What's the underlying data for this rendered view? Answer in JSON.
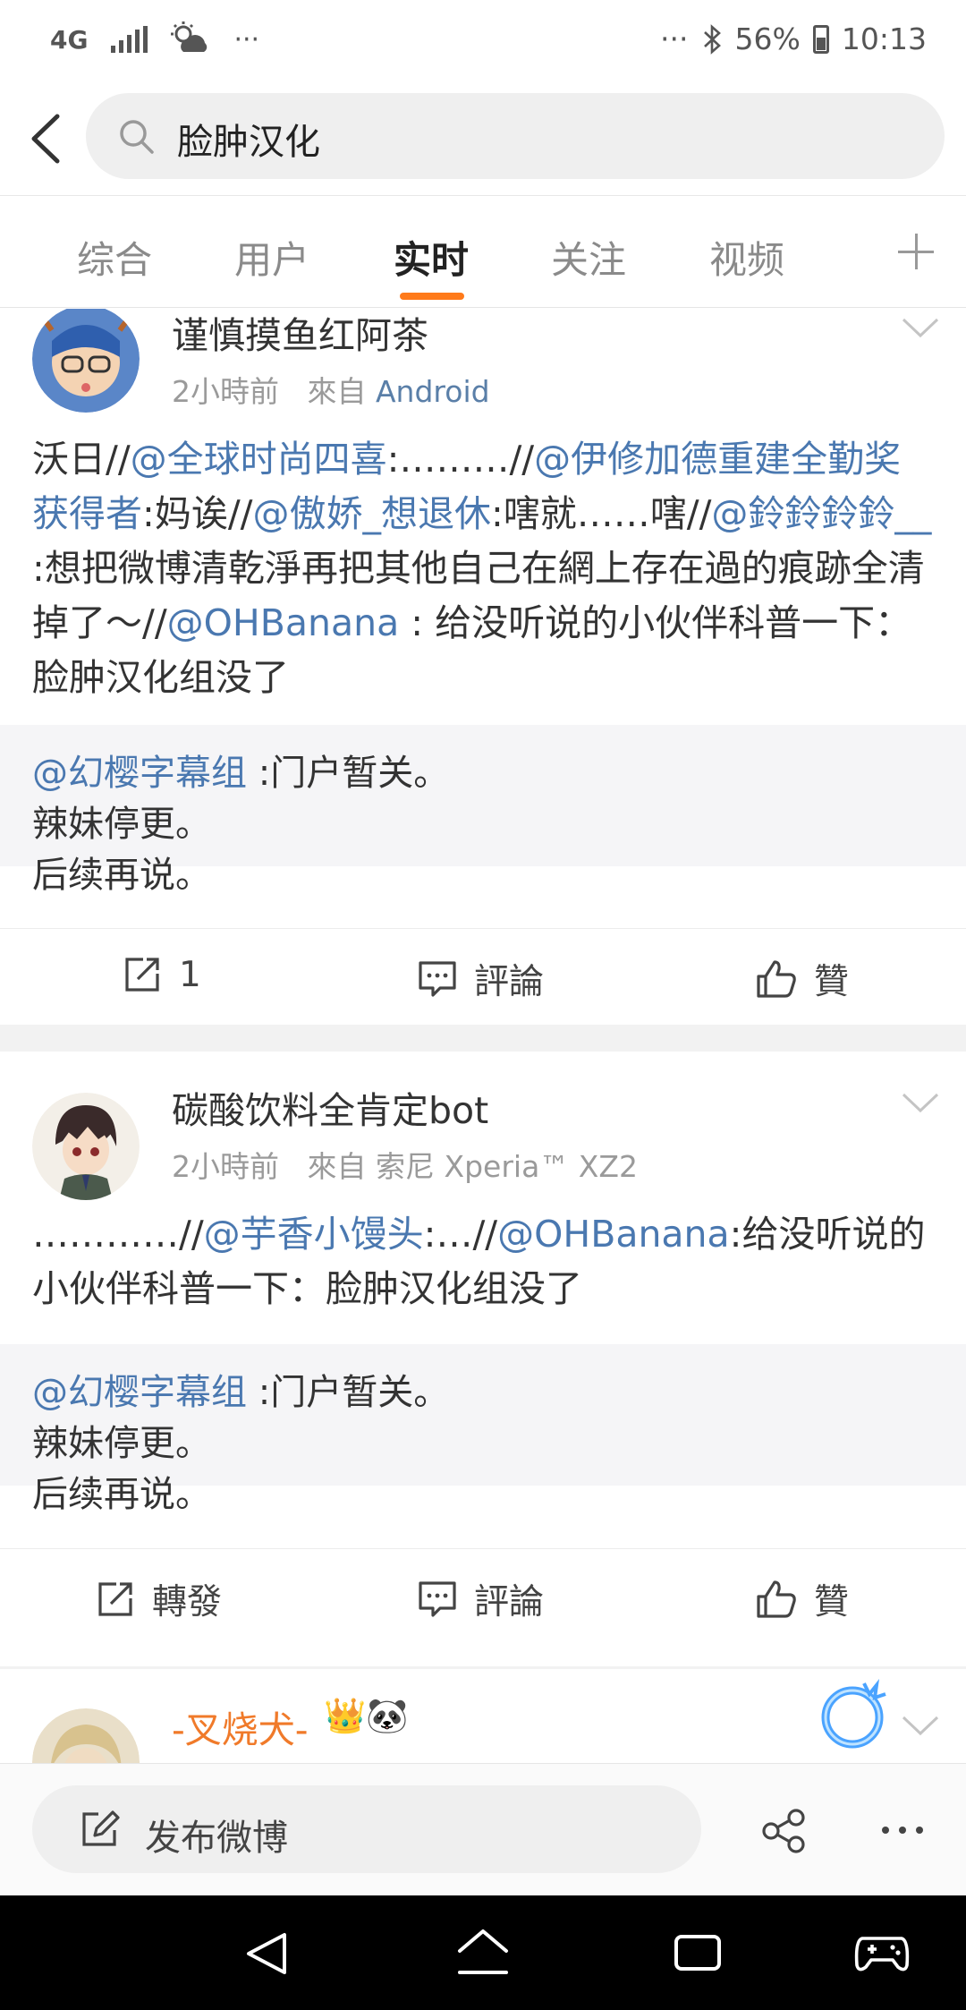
{
  "status_bar": {
    "network": "4G",
    "dots": "···",
    "right_dots": "···",
    "battery": "56%",
    "time": "10:13"
  },
  "search": {
    "query": "脸肿汉化"
  },
  "tabs": [
    {
      "label": "综合"
    },
    {
      "label": "用户"
    },
    {
      "label": "实时"
    },
    {
      "label": "关注"
    },
    {
      "label": "视频"
    }
  ],
  "active_tab": "实时",
  "posts": [
    {
      "author": "谨慎摸鱼红阿茶",
      "time": "2小時前",
      "from_label": "來自",
      "source": "Android",
      "text_parts": [
        {
          "t": "沃日//",
          "m": false
        },
        {
          "t": "@全球时尚四喜",
          "m": true
        },
        {
          "t": ":………//",
          "m": false
        },
        {
          "t": "@伊修加德重建全勤奖获得者",
          "m": true
        },
        {
          "t": ":妈诶//",
          "m": false
        },
        {
          "t": "@傲娇_想退休",
          "m": true
        },
        {
          "t": ":嗐就……嗐//",
          "m": false
        },
        {
          "t": "@鈴鈴鈴鈴__",
          "m": true
        },
        {
          "t": " :想把微博清乾淨再把其他自己在網上存在過的痕跡全清掉了～//",
          "m": false
        },
        {
          "t": "@OHBanana",
          "m": true
        },
        {
          "t": " : 给没听说的小伙伴科普一下：脸肿汉化组没了",
          "m": false
        }
      ],
      "quote_author": "@幻樱字幕组",
      "quote_lines": [
        ":门户暂关。",
        "辣妹停更。",
        "后续再说。"
      ],
      "repost_label": "1",
      "comment_label": "評論",
      "like_label": "贊"
    },
    {
      "author": "碳酸饮料全肯定bot",
      "time": "2小時前",
      "from_label": "來自",
      "source": "索尼 Xperia™ XZ2",
      "text_parts": [
        {
          "t": "…………//",
          "m": false
        },
        {
          "t": "@芋香小馒头",
          "m": true
        },
        {
          "t": ":…//",
          "m": false
        },
        {
          "t": "@OHBanana",
          "m": true
        },
        {
          "t": ":给没听说的小伙伴科普一下：脸肿汉化组没了",
          "m": false
        }
      ],
      "quote_author": "@幻樱字幕组",
      "quote_lines": [
        ":门户暂关。",
        "辣妹停更。",
        "后续再说。"
      ],
      "repost_label": "轉發",
      "comment_label": "評論",
      "like_label": "贊"
    },
    {
      "author": "-叉烧犬-",
      "emoji": "👑🐼"
    }
  ],
  "compose": {
    "label": "发布微博"
  },
  "colors": {
    "accent": "#ff7a1a",
    "mention": "#4a78b0",
    "author_orange": "#f07a2a"
  }
}
